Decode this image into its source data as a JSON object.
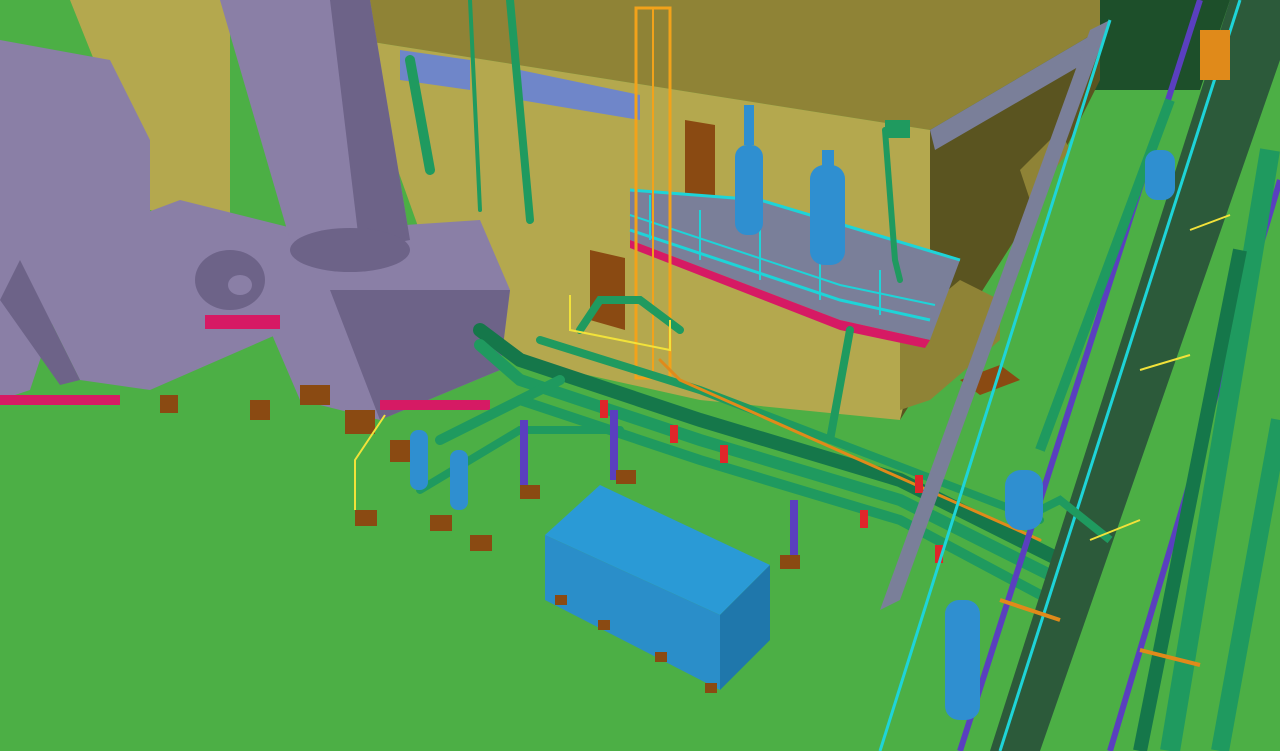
{
  "scene": {
    "colors": {
      "ground": "#4caf45",
      "building_wall": "#b4a84e",
      "building_roof": "#8f8336",
      "building_shadow": "#5a5420",
      "duct": "#8a7fa6",
      "duct_dark": "#6d6388",
      "pipe": "#1f9a5f",
      "pipe_dark": "#15774a",
      "railing": "#1ed4d8",
      "ladder": "#f2a21a",
      "vessel": "#2f8fd0",
      "tank": "#2a8ec9",
      "steel": "#5a3fbf",
      "support": "#8a4a12",
      "red_marker": "#e0262a",
      "magenta": "#d61a64",
      "window": "#6f86c9",
      "slab": "#7a7f99",
      "dark_bg": "#1d4f2a"
    },
    "objects": [
      "building",
      "exhaust-duct-system",
      "exhaust-stack",
      "elevated-platform",
      "vertical-vessel",
      "cage-ladder",
      "pipe-rack",
      "storage-tank",
      "structural-frame"
    ]
  }
}
